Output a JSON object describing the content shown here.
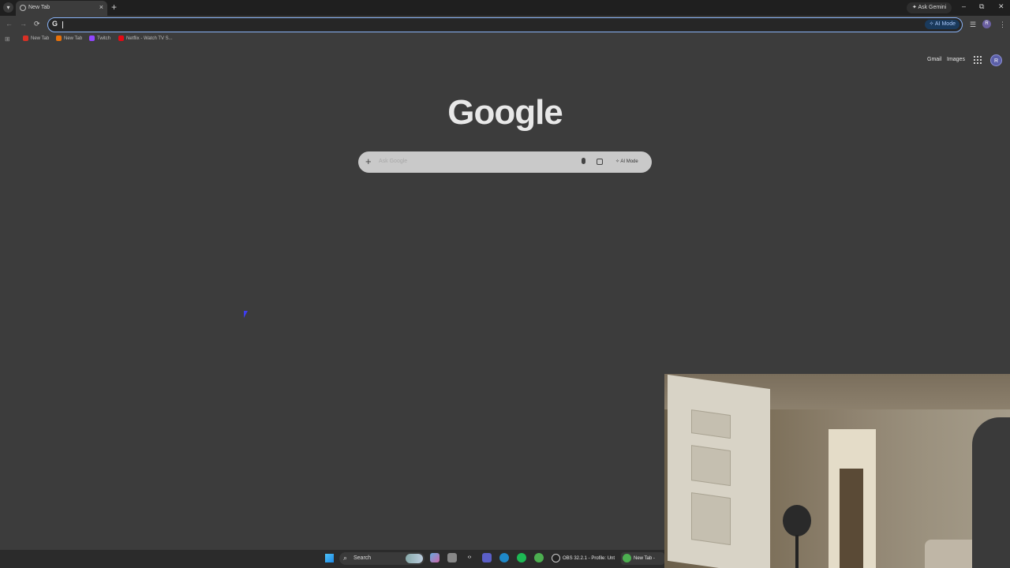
{
  "browser": {
    "tab": {
      "title": "New Tab",
      "close": "×"
    },
    "new_tab": "+",
    "ask_gemini": "Ask Gemini",
    "window": {
      "minimize": "–",
      "restore": "⧉",
      "close": "✕"
    },
    "nav": {
      "back": "←",
      "forward": "→",
      "reload": "⟳"
    },
    "omnibox": {
      "value": "",
      "ai_mode": "AI Mode"
    }
  },
  "bookmarks": [
    {
      "label": "New Tab",
      "color": "#d93025"
    },
    {
      "label": "New Tab",
      "color": "#e8710a"
    },
    {
      "label": "Twitch",
      "color": "#9146ff"
    },
    {
      "label": "Netflix - Watch TV S...",
      "color": "#e50914"
    }
  ],
  "page": {
    "links": {
      "gmail": "Gmail",
      "images": "Images"
    },
    "avatar_letter": "R",
    "logo": "Google",
    "search": {
      "placeholder": "Ask Google",
      "ai_mode": "AI Mode"
    }
  },
  "taskbar": {
    "search_label": "Search",
    "tasks": [
      {
        "label": "OBS 32.2.1 - Profile: Unt"
      },
      {
        "label": "New Tab - Go"
      }
    ]
  },
  "colors": {
    "page_bg": "#3c3c3c",
    "accent": "#8ab4f8"
  }
}
